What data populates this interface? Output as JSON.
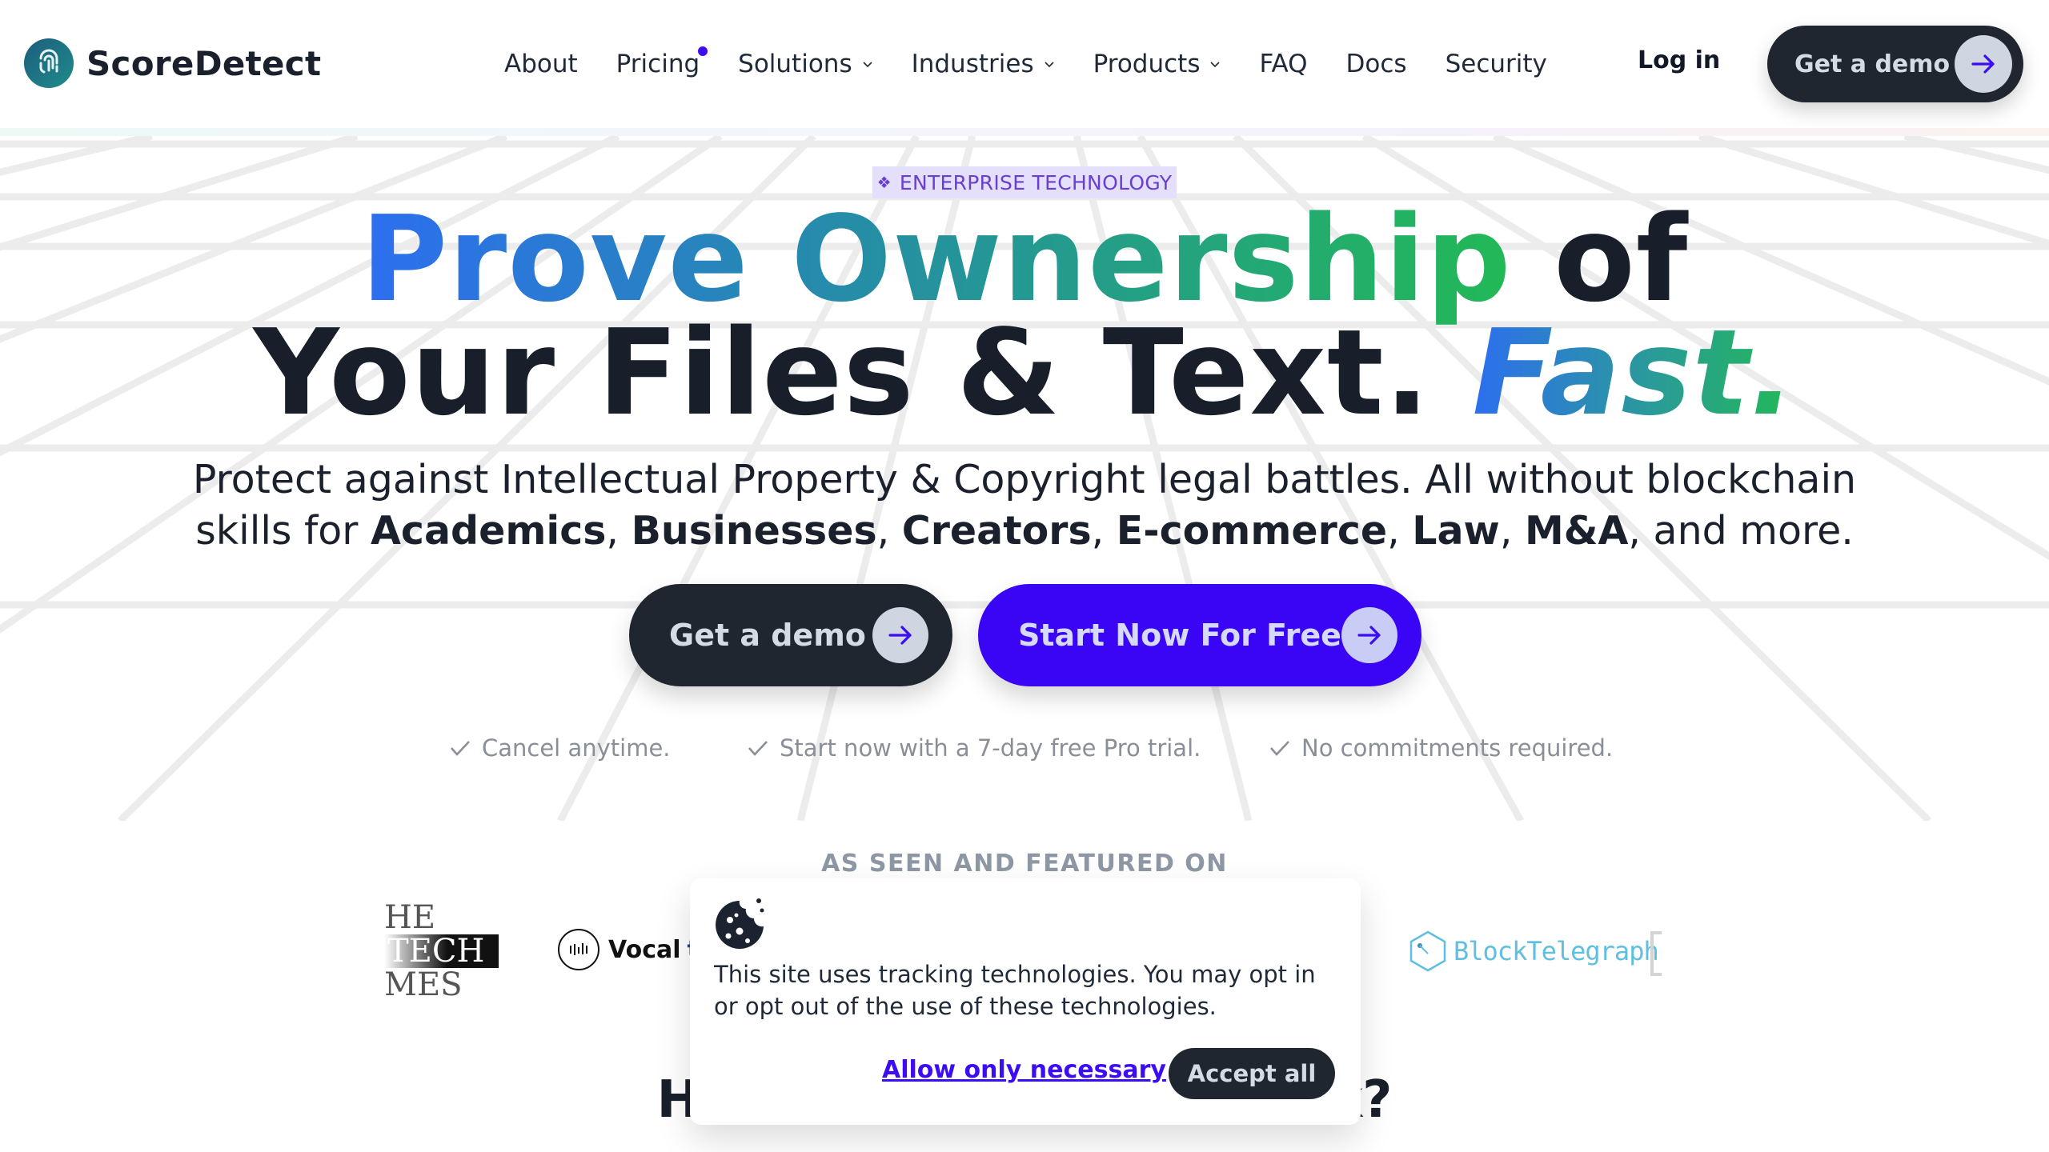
{
  "brand": {
    "name": "ScoreDetect",
    "logo_icon": "fingerprint-icon"
  },
  "nav": {
    "items": [
      {
        "label": "About",
        "dropdown": false
      },
      {
        "label": "Pricing",
        "dropdown": false,
        "dot": true
      },
      {
        "label": "Solutions",
        "dropdown": true
      },
      {
        "label": "Industries",
        "dropdown": true
      },
      {
        "label": "Products",
        "dropdown": true
      },
      {
        "label": "FAQ",
        "dropdown": false
      },
      {
        "label": "Docs",
        "dropdown": false
      },
      {
        "label": "Security",
        "dropdown": false
      }
    ],
    "login_label": "Log in",
    "demo_label": "Get a demo"
  },
  "hero": {
    "badge": {
      "icon": "diamond-icon",
      "label": "ENTERPRISE TECHNOLOGY"
    },
    "title_line1_gradient": "Prove Ownership",
    "title_line1_rest": " of",
    "title_line2_plain": "Your Files & Text. ",
    "title_line2_gradient": "Fast.",
    "subtitle_line1": "Protect against Intellectual Property & Copyright legal battles. All without blockchain",
    "subtitle_line2_prefix": "skills for ",
    "audiences": [
      "Academics",
      "Businesses",
      "Creators",
      "E-commerce",
      "Law",
      "M&A"
    ],
    "subtitle_line2_suffix": ", and more.",
    "cta_demo": "Get a demo",
    "cta_start": "Start Now For Free",
    "checks": [
      "Cancel anytime.",
      "Start now with a 7-day free Pro trial.",
      "No commitments required."
    ]
  },
  "featured": {
    "heading": "AS SEEN AND FEATURED ON",
    "logos": {
      "techtimes": [
        "HE",
        "TECH",
        "MES"
      ],
      "vocal": [
        "Vocal",
        "t"
      ],
      "blocktelegraph": "BlockTelegraph"
    }
  },
  "section_heading_partial": {
    "left": "Ho",
    "right": "rk?"
  },
  "cookie": {
    "icon": "cookie-icon",
    "text": "This site uses tracking technologies. You may opt in or opt out of the use of these technologies.",
    "allow_label": "Allow only necessary",
    "accept_label": "Accept all"
  },
  "colors": {
    "accent": "#3d0df2",
    "dark": "#1f2630",
    "teal": "#1f8c8a"
  }
}
